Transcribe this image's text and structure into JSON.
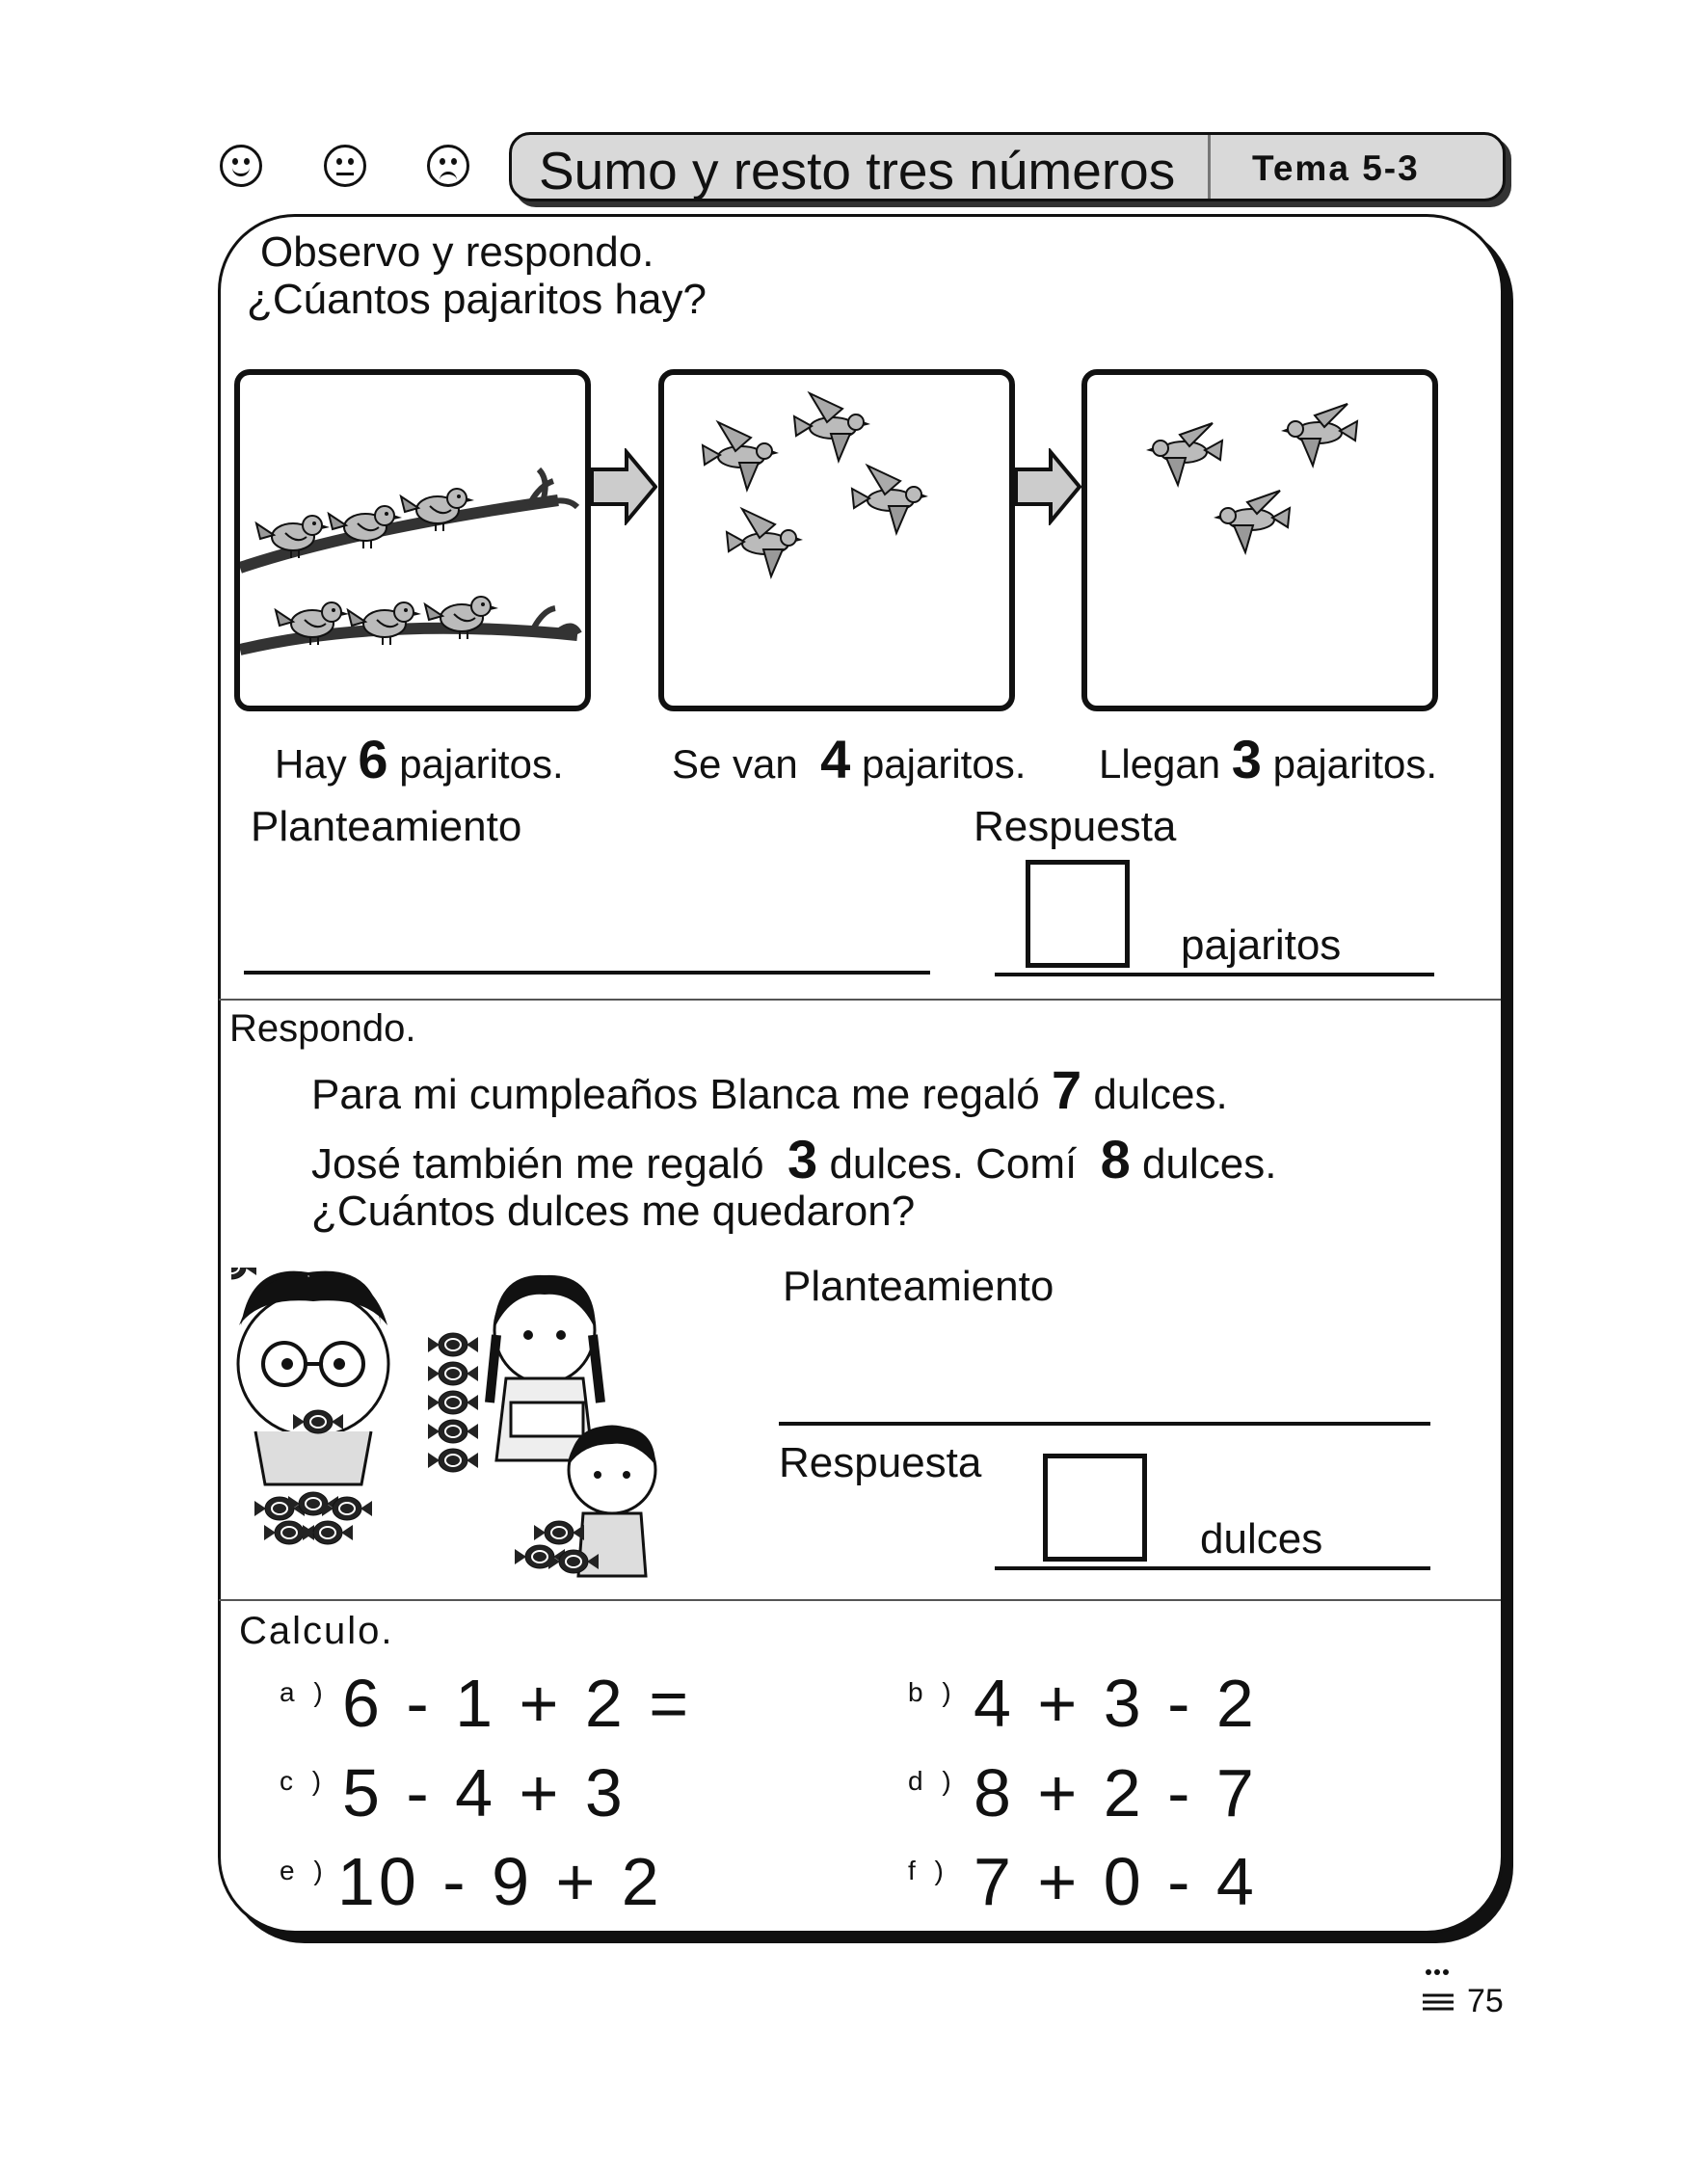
{
  "header": {
    "faces": [
      "smiley-happy",
      "smiley-neutral",
      "smiley-sad"
    ],
    "title": "Sumo y resto tres números",
    "tema": "Tema 5-3"
  },
  "section1": {
    "instruction": "Observo y respondo.",
    "question": "¿Cúantos pajaritos hay?",
    "captions": [
      {
        "pre": "Hay",
        "num": "6",
        "post": "pajaritos."
      },
      {
        "pre": "Se van",
        "num": "4",
        "post": "pajaritos."
      },
      {
        "pre": "Llegan",
        "num": "3",
        "post": "pajaritos."
      }
    ],
    "planteamiento_label": "Planteamiento",
    "respuesta_label": "Respuesta",
    "answer_unit": "pajaritos"
  },
  "section2": {
    "instruction": "Respondo.",
    "line1_pre": "Para mi cumpleaños Blanca me regaló",
    "line1_num": "7",
    "line1_post": "dulces.",
    "line2_pre": "José también me regaló",
    "line2_num1": "3",
    "line2_mid": "dulces. Comí",
    "line2_num2": "8",
    "line2_post": "dulces.",
    "line3": "¿Cuántos dulces me quedaron?",
    "planteamiento_label": "Planteamiento",
    "respuesta_label": "Respuesta",
    "answer_unit": "dulces"
  },
  "section3": {
    "instruction": "Calculo.",
    "items": [
      {
        "letter": "a )",
        "expr": "6 - 1 + 2 ="
      },
      {
        "letter": "b )",
        "expr": "4 + 3 - 2"
      },
      {
        "letter": "c )",
        "expr": "5 - 4 + 3"
      },
      {
        "letter": "d )",
        "expr": "8 + 2 - 7"
      },
      {
        "letter": "e )",
        "expr": "10 - 9 + 2"
      },
      {
        "letter": "f )",
        "expr": "7 + 0 - 4"
      }
    ]
  },
  "footer": {
    "page_number": "75"
  }
}
